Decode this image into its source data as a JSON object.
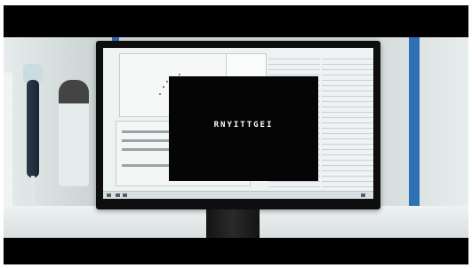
{
  "video_frame": {
    "screen_dialog": {
      "text": "RNYITTGEI"
    },
    "colors": {
      "letterbox": "#000000",
      "dialog_bg": "#050505",
      "dialog_text": "#ffffff",
      "accent_pillar": "#2f6fb4",
      "screen_bg": "#eef2f3"
    }
  }
}
